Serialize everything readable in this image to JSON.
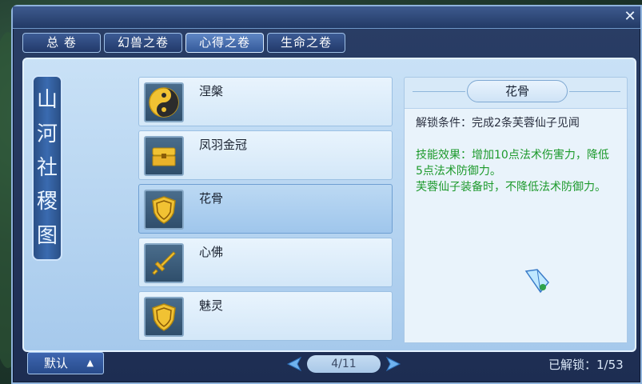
{
  "window": {
    "close_glyph": "✕"
  },
  "tabs": [
    {
      "label": "总 卷",
      "active": false
    },
    {
      "label": "幻兽之卷",
      "active": false
    },
    {
      "label": "心得之卷",
      "active": true
    },
    {
      "label": "生命之卷",
      "active": false
    }
  ],
  "banner": {
    "chars": [
      "山",
      "河",
      "社",
      "稷",
      "图"
    ]
  },
  "skills": [
    {
      "name": "涅槃",
      "icon": "yin-yang-icon"
    },
    {
      "name": "凤羽金冠",
      "icon": "treasure-chest-icon"
    },
    {
      "name": "花骨",
      "icon": "shield-icon",
      "selected": true
    },
    {
      "name": "心佛",
      "icon": "sword-icon"
    },
    {
      "name": "魅灵",
      "icon": "shield-icon"
    }
  ],
  "detail": {
    "title": "花骨",
    "unlock": "解锁条件：完成2条芙蓉仙子见闻",
    "effect": "技能效果：增加10点法术伤害力，降低5点法术防御力。",
    "note": "芙蓉仙子装备时，不降低法术防御力。"
  },
  "footer": {
    "default_label": "默认",
    "default_arrow": "▲",
    "page_text": "4/11",
    "unlocked_text": "已解锁：1/53"
  },
  "colors": {
    "accent_blue": "#3a6bb0",
    "effect_green": "#1d9a2c"
  }
}
